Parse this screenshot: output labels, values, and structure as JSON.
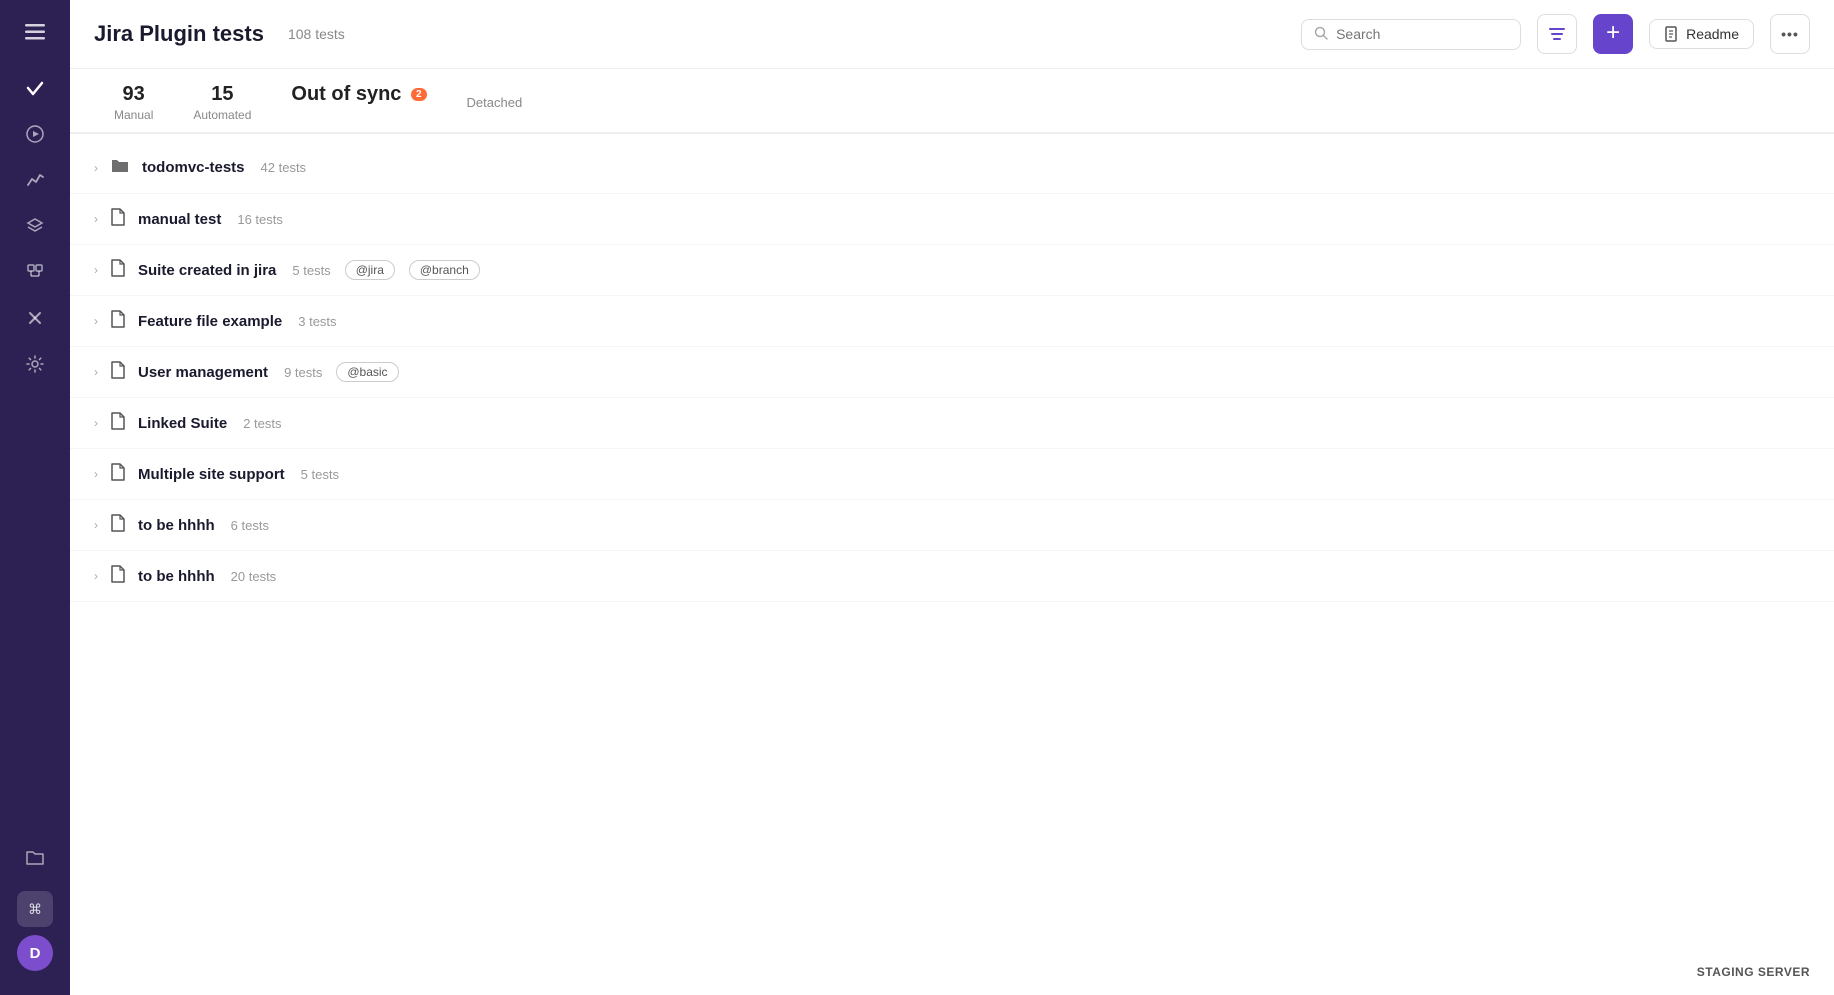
{
  "sidebar": {
    "items": [
      {
        "name": "menu",
        "icon": "☰",
        "active": false
      },
      {
        "name": "check",
        "icon": "✓",
        "active": true
      },
      {
        "name": "play",
        "icon": "▶",
        "active": false
      },
      {
        "name": "chart",
        "icon": "≋",
        "active": false
      },
      {
        "name": "layers",
        "icon": "⬡",
        "active": false
      },
      {
        "name": "plugin",
        "icon": "⎘",
        "active": false
      },
      {
        "name": "tools",
        "icon": "✂",
        "active": false
      },
      {
        "name": "settings",
        "icon": "⚙",
        "active": false
      },
      {
        "name": "folder",
        "icon": "🗂",
        "active": false
      }
    ],
    "avatar_label": "D",
    "shortcut_icon": "⌘"
  },
  "header": {
    "title": "Jira Plugin tests",
    "test_count": "108 tests",
    "search_placeholder": "Search",
    "readme_label": "Readme",
    "more_icon": "•••"
  },
  "tabs": [
    {
      "id": "manual",
      "count": "93",
      "label": "Manual"
    },
    {
      "id": "automated",
      "count": "15",
      "label": "Automated"
    },
    {
      "id": "out_of_sync",
      "count": "Out of",
      "label": "sync",
      "badge": "2"
    },
    {
      "id": "detached",
      "label": "Detached"
    }
  ],
  "suites": [
    {
      "name": "todomvc-tests",
      "count": "42 tests",
      "icon": "folder",
      "tags": []
    },
    {
      "name": "manual test",
      "count": "16 tests",
      "icon": "file",
      "tags": []
    },
    {
      "name": "Suite created in jira",
      "count": "5 tests",
      "icon": "file",
      "tags": [
        "@jira",
        "@branch"
      ]
    },
    {
      "name": "Feature file example",
      "count": "3 tests",
      "icon": "file",
      "tags": []
    },
    {
      "name": "User management",
      "count": "9 tests",
      "icon": "file",
      "tags": [
        "@basic"
      ]
    },
    {
      "name": "Linked Suite",
      "count": "2 tests",
      "icon": "file",
      "tags": []
    },
    {
      "name": "Multiple site support",
      "count": "5 tests",
      "icon": "file",
      "tags": []
    },
    {
      "name": "to be hhhh",
      "count": "6 tests",
      "icon": "file",
      "tags": []
    },
    {
      "name": "to be hhhh",
      "count": "20 tests",
      "icon": "file",
      "tags": []
    }
  ],
  "staging_label": "STAGING SERVER"
}
